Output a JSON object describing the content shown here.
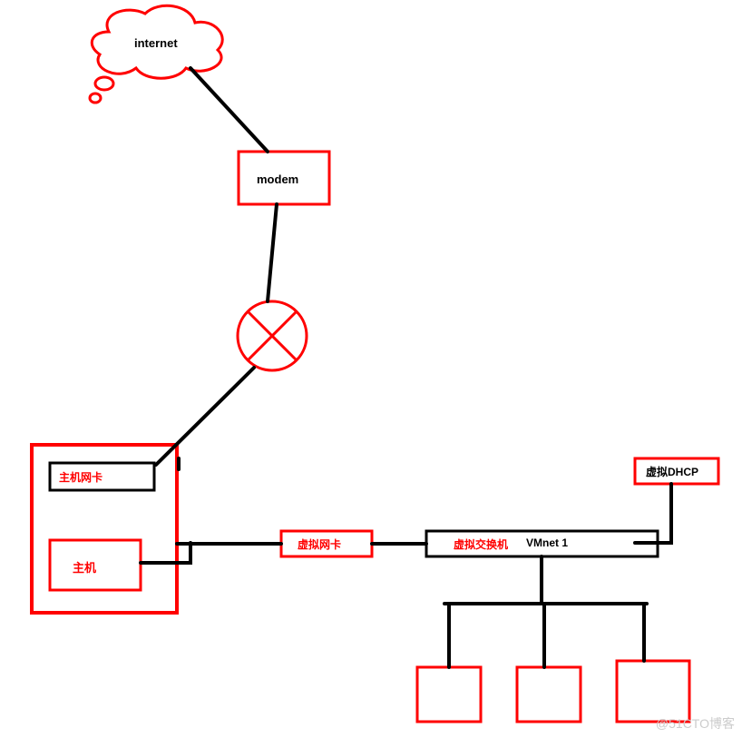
{
  "diagram": {
    "internet": "internet",
    "modem": "modem",
    "host_nic": "主机网卡",
    "host": "主机",
    "virtual_nic": "虚拟网卡",
    "virtual_switch": "虚拟交换机",
    "vmnet": "VMnet 1",
    "virtual_dhcp": "虚拟DHCP"
  },
  "watermark": "@51CTO博客"
}
